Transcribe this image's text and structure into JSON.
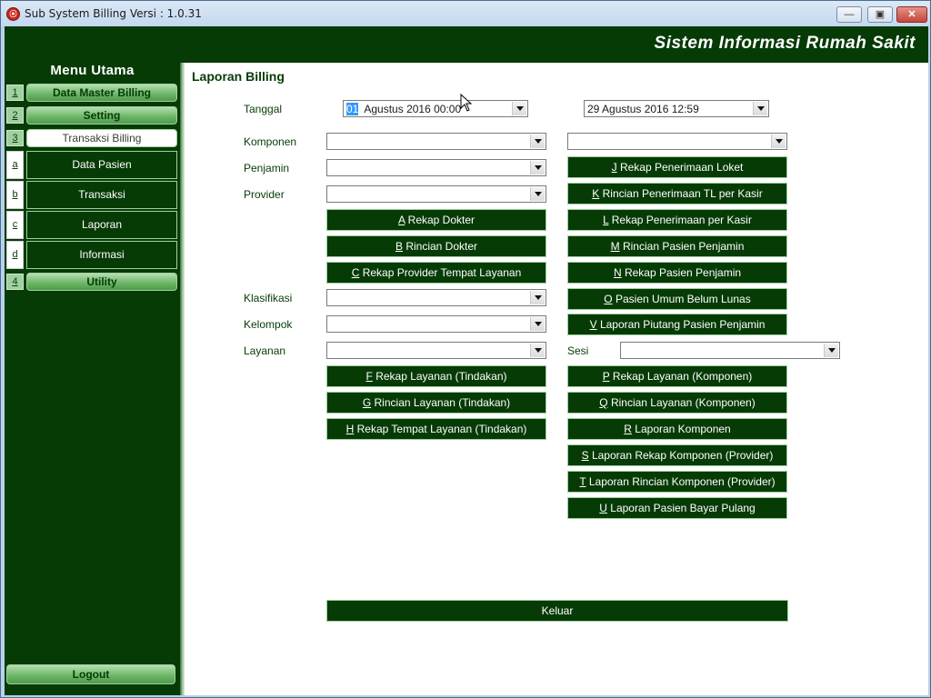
{
  "window": {
    "title": "Sub System Billing Versi : 1.0.31"
  },
  "header": {
    "title": "Sistem Informasi Rumah Sakit"
  },
  "sidebar": {
    "title": "Menu Utama",
    "items": [
      {
        "num": "1",
        "label": "Data Master Billing"
      },
      {
        "num": "2",
        "label": "Setting"
      },
      {
        "num": "3",
        "label": "Transaksi Billing"
      }
    ],
    "sub_items": [
      {
        "num": "a",
        "label": "Data Pasien"
      },
      {
        "num": "b",
        "label": "Transaksi"
      },
      {
        "num": "c",
        "label": "Laporan"
      },
      {
        "num": "d",
        "label": "Informasi"
      }
    ],
    "utility": {
      "num": "4",
      "label": "Utility"
    },
    "logout_label": "Logout"
  },
  "main": {
    "title": "Laporan Billing",
    "labels": {
      "tanggal": "Tanggal",
      "komponen": "Komponen",
      "penjamin": "Penjamin",
      "provider": "Provider",
      "klasifikasi": "Klasifikasi",
      "kelompok": "Kelompok",
      "layanan": "Layanan",
      "sesi": "Sesi"
    },
    "date_from": {
      "day": "01",
      "rest": "Agustus   2016 00:00"
    },
    "date_to": "29  Agustus   2016 12:59",
    "left_buttons": [
      {
        "key": "A",
        "label": "Rekap Dokter"
      },
      {
        "key": "B",
        "label": "Rincian Dokter"
      },
      {
        "key": "C",
        "label": "Rekap Provider Tempat Layanan"
      },
      {
        "key": "F",
        "label": "Rekap Layanan (Tindakan)"
      },
      {
        "key": "G",
        "label": "Rincian Layanan (Tindakan)"
      },
      {
        "key": "H",
        "label": "Rekap Tempat Layanan (Tindakan)"
      }
    ],
    "right_buttons": [
      {
        "key": "J",
        "label": "Rekap Penerimaan Loket"
      },
      {
        "key": "K",
        "label": "Rincian Penerimaan TL per Kasir"
      },
      {
        "key": "L",
        "label": "Rekap Penerimaan per Kasir"
      },
      {
        "key": "M",
        "label": "Rincian Pasien Penjamin"
      },
      {
        "key": "N",
        "label": "Rekap Pasien Penjamin"
      },
      {
        "key": "O",
        "label": "Pasien Umum Belum Lunas"
      },
      {
        "key": "V",
        "label": "Laporan Piutang Pasien Penjamin"
      },
      {
        "key": "P",
        "label": "Rekap Layanan (Komponen)"
      },
      {
        "key": "Q",
        "label": "Rincian Layanan (Komponen)"
      },
      {
        "key": "R",
        "label": "Laporan Komponen"
      },
      {
        "key": "S",
        "label": "Laporan Rekap Komponen (Provider)"
      },
      {
        "key": "T",
        "label": "Laporan Rincian Komponen (Provider)"
      },
      {
        "key": "U",
        "label": "Laporan Pasien Bayar Pulang"
      }
    ],
    "keluar_label": "Keluar"
  },
  "colors": {
    "brand_green": "#063b06",
    "accent_green": "#6fb86a"
  },
  "icons": [
    "app-icon",
    "minimize-icon",
    "maximize-icon",
    "close-icon",
    "chevron-down-icon",
    "mouse-cursor-icon"
  ]
}
